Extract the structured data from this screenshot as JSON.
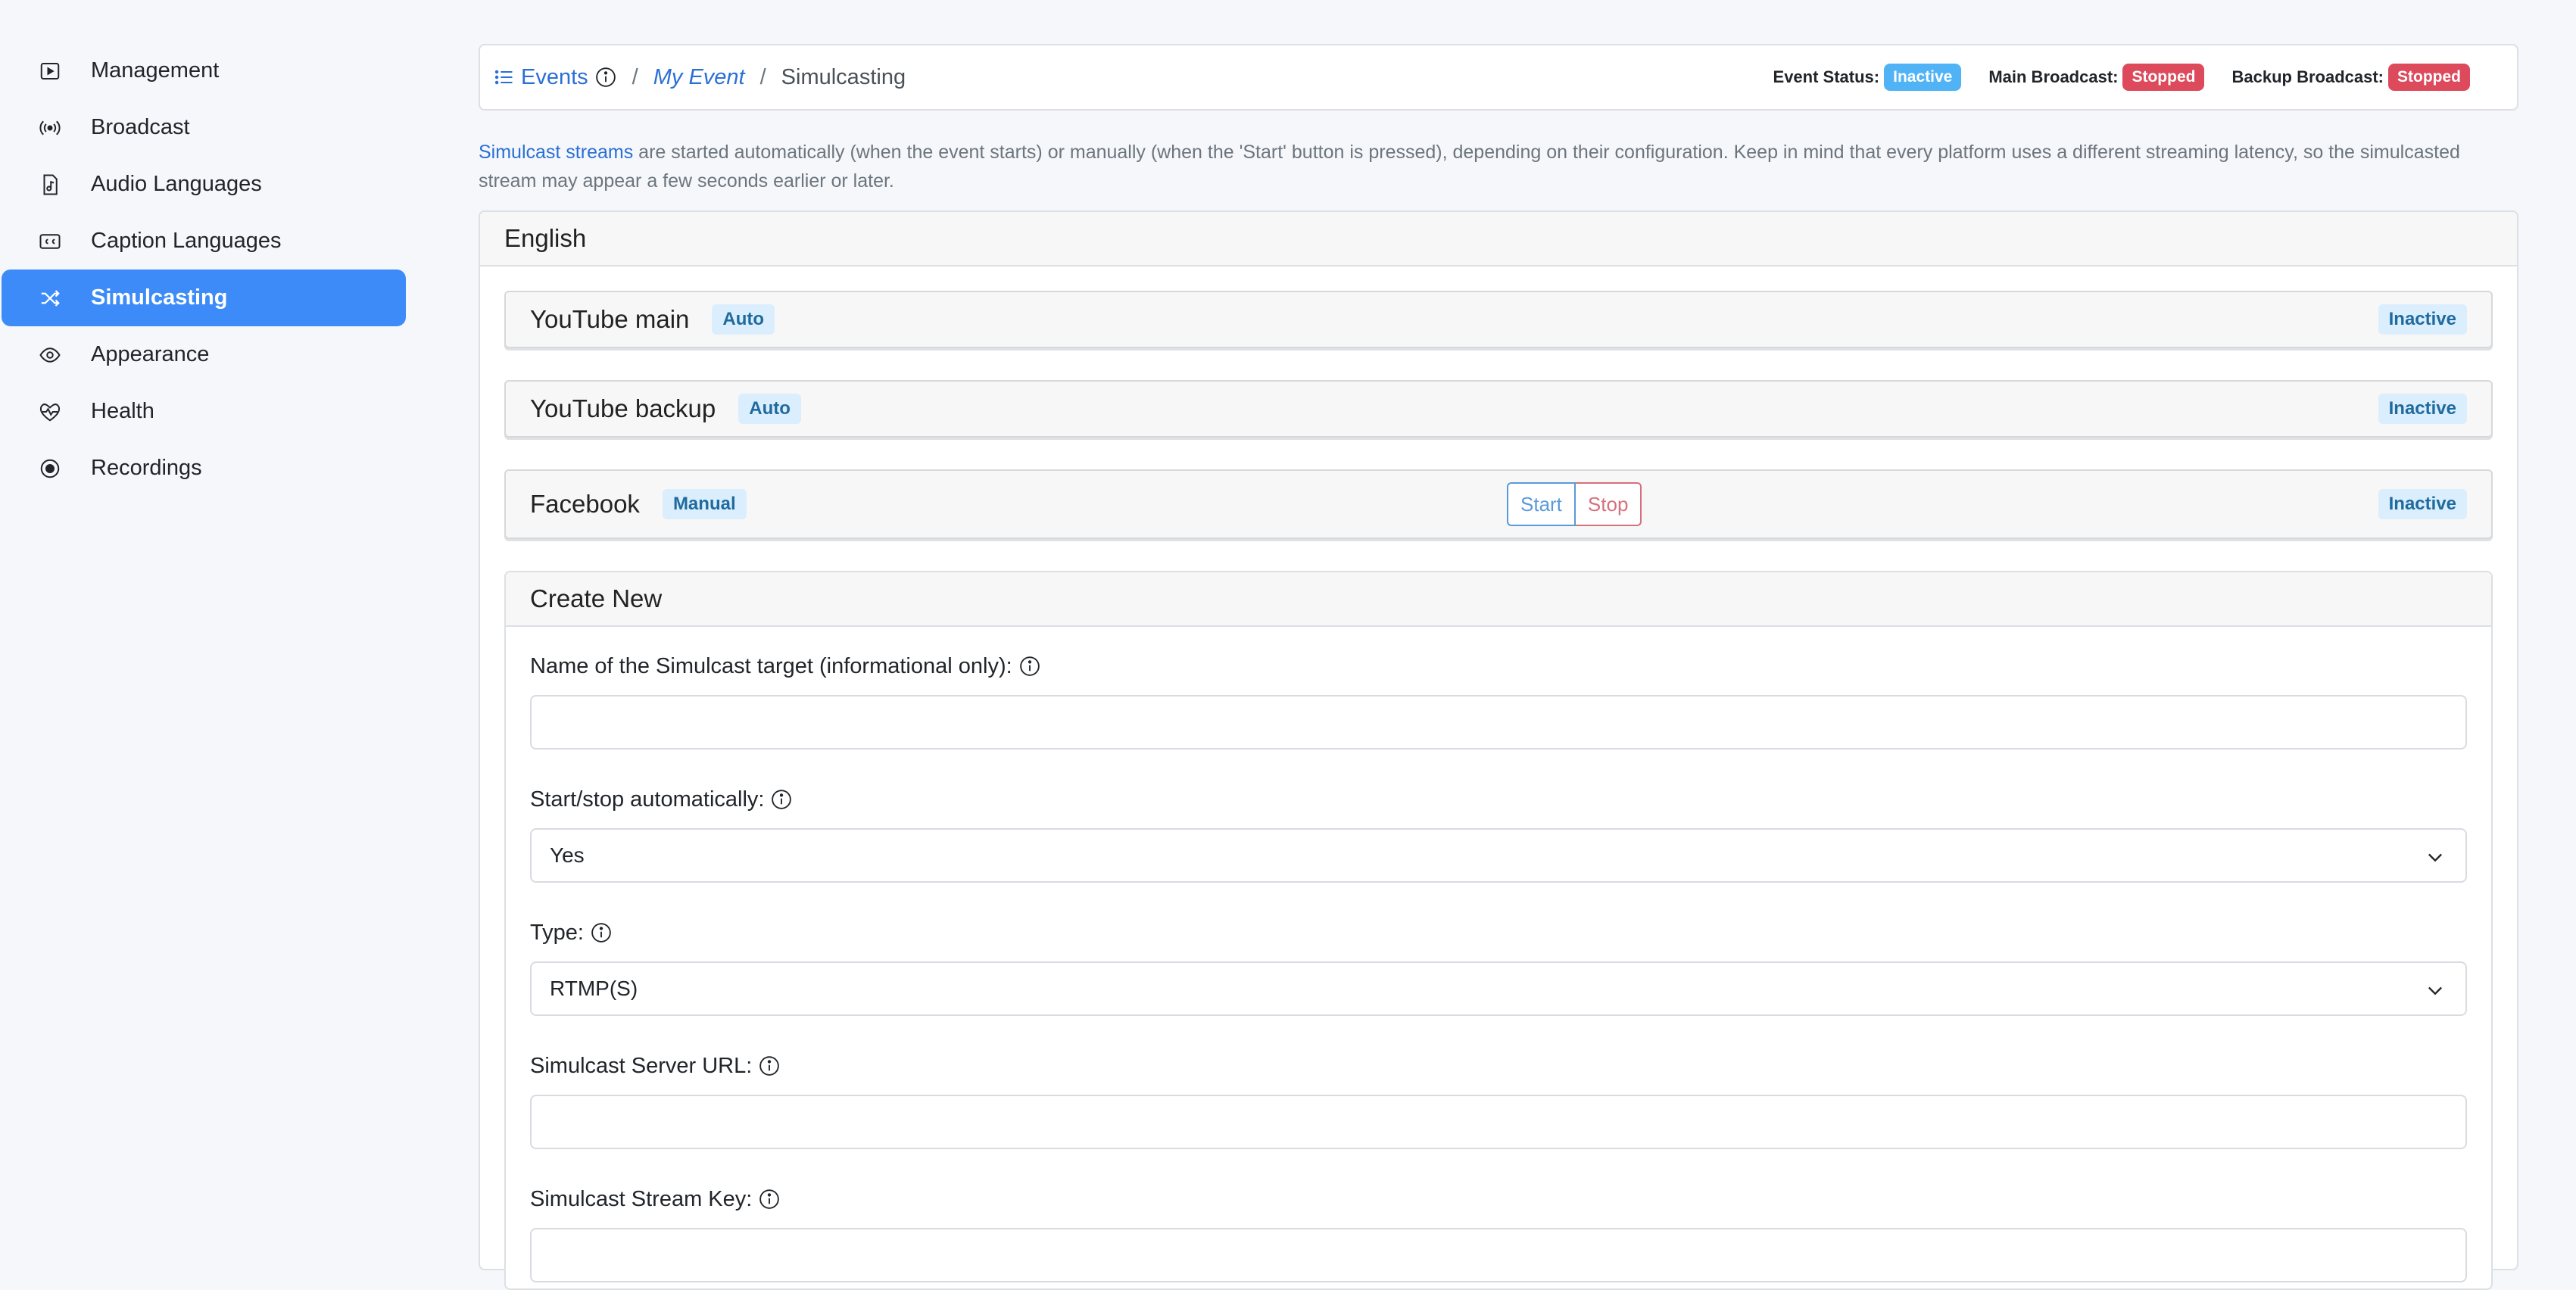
{
  "sidebar": {
    "items": [
      {
        "label": "Management",
        "icon": "play-square-icon"
      },
      {
        "label": "Broadcast",
        "icon": "broadcast-icon"
      },
      {
        "label": "Audio Languages",
        "icon": "music-file-icon"
      },
      {
        "label": "Caption Languages",
        "icon": "cc-icon"
      },
      {
        "label": "Simulcasting",
        "icon": "shuffle-icon",
        "active": true
      },
      {
        "label": "Appearance",
        "icon": "eye-icon"
      },
      {
        "label": "Health",
        "icon": "heart-pulse-icon"
      },
      {
        "label": "Recordings",
        "icon": "record-icon"
      }
    ]
  },
  "breadcrumb": {
    "events": "Events",
    "sep1": "/",
    "event": "My Event",
    "sep2": "/",
    "current": "Simulcasting"
  },
  "status": {
    "event_label": "Event Status:",
    "event_value": "Inactive",
    "main_label": "Main Broadcast:",
    "main_value": "Stopped",
    "backup_label": "Backup Broadcast:",
    "backup_value": "Stopped"
  },
  "intro": {
    "link": "Simulcast streams",
    "text": " are started automatically (when the event starts) or manually (when the 'Start' button is pressed), depending on their configuration. Keep in mind that every platform uses a different streaming latency, so the simulcasted stream may appear a few seconds earlier or later."
  },
  "language": {
    "title": "English",
    "streams": [
      {
        "name": "YouTube main",
        "mode": "Auto",
        "status": "Inactive"
      },
      {
        "name": "YouTube backup",
        "mode": "Auto",
        "status": "Inactive"
      },
      {
        "name": "Facebook",
        "mode": "Manual",
        "status": "Inactive",
        "start": "Start",
        "stop": "Stop"
      }
    ]
  },
  "create": {
    "title": "Create New",
    "name_label": "Name of the Simulcast target (informational only):",
    "name_value": "",
    "auto_label": "Start/stop automatically:",
    "auto_value": "Yes",
    "type_label": "Type:",
    "type_value": "RTMP(S)",
    "url_label": "Simulcast Server URL:",
    "url_value": "",
    "key_label": "Simulcast Stream Key:",
    "key_value": ""
  },
  "colors": {
    "accent": "#3d8bf8",
    "link": "#2a6fd6",
    "info_badge": "#4fb3f6",
    "danger_badge": "#dc4a5c"
  }
}
